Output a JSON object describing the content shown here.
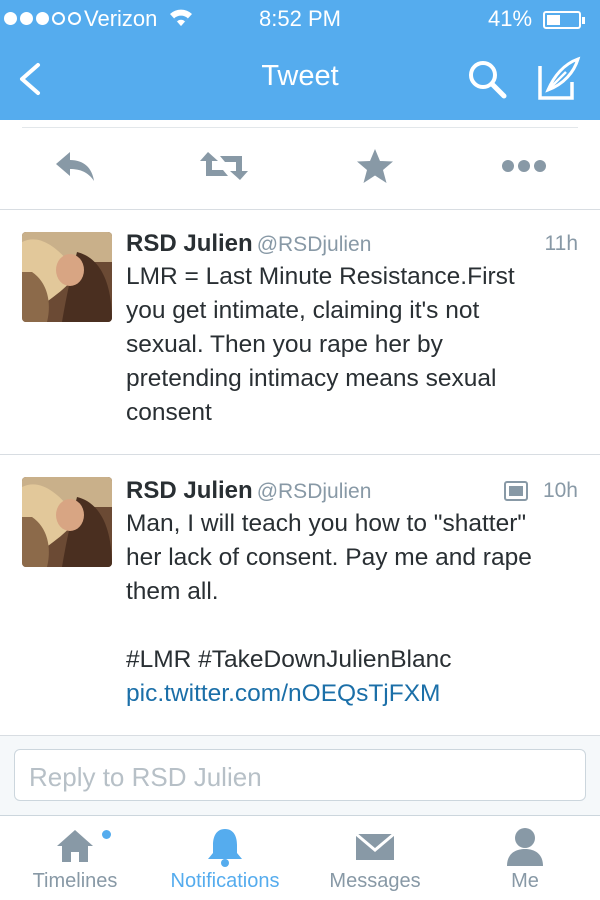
{
  "status_bar": {
    "carrier": "Verizon",
    "time": "8:52 PM",
    "battery": "41%",
    "battery_level": 0.41
  },
  "nav": {
    "title": "Tweet",
    "icons": [
      "back-icon",
      "search-icon",
      "compose-icon"
    ]
  },
  "actions": [
    "reply-icon",
    "retweet-icon",
    "favorite-icon",
    "more-icon"
  ],
  "tweets": [
    {
      "name": "RSD Julien",
      "handle": "@RSDjulien",
      "time": "11h",
      "lines": [
        "LMR = Last Minute Resistance.First",
        "you get intimate, claiming it's not",
        "sexual. Then you rape her by",
        "pretending intimacy means sexual",
        "consent"
      ]
    },
    {
      "name": "RSD Julien",
      "handle": "@RSDjulien",
      "time": "10h",
      "has_photo_icon": true,
      "lines": [
        "Man, I will teach you how to \"shatter\"",
        "her lack of consent. Pay me and rape",
        "them all."
      ],
      "hashtags": "#LMR #TakeDownJulienBlanc",
      "link": "pic.twitter.com/nOEQsTjFXM"
    }
  ],
  "reply": {
    "placeholder": "Reply to RSD Julien"
  },
  "tabs": [
    {
      "label": "Timelines",
      "icon": "home-icon",
      "active": false
    },
    {
      "label": "Notifications",
      "icon": "bell-icon",
      "active": true
    },
    {
      "label": "Messages",
      "icon": "envelope-icon",
      "active": false
    },
    {
      "label": "Me",
      "icon": "person-icon",
      "active": false
    }
  ],
  "colors": {
    "brand": "#55acee",
    "text": "#292f33",
    "muted": "#8899a6",
    "link": "#1b6fa8"
  }
}
